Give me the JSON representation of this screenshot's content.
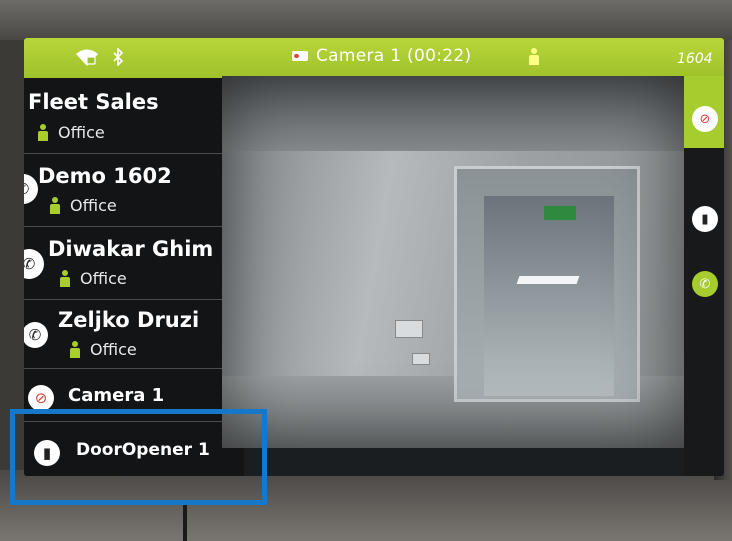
{
  "status_bar": {
    "camera_label": "Camera 1 (00:22)",
    "extension": "1604",
    "left_icons": [
      "wifi-lock-icon",
      "bluetooth-icon"
    ],
    "accent": "#a6cc2e"
  },
  "contacts": [
    {
      "name": "Fleet Sales",
      "status": "Office"
    },
    {
      "name": "Demo 1602",
      "status": "Office"
    },
    {
      "name": "Diwakar Ghim",
      "status": "Office"
    },
    {
      "name": "Zeljko Druzi",
      "status": "Office"
    }
  ],
  "devices": [
    {
      "name": "Camera 1",
      "icon": "camera-off-icon"
    },
    {
      "name": "DoorOpener 1",
      "icon": "door-icon"
    }
  ],
  "side_actions": [
    "camera-off-icon",
    "door-icon",
    "phone-icon"
  ],
  "highlight_color": "#1777c8"
}
